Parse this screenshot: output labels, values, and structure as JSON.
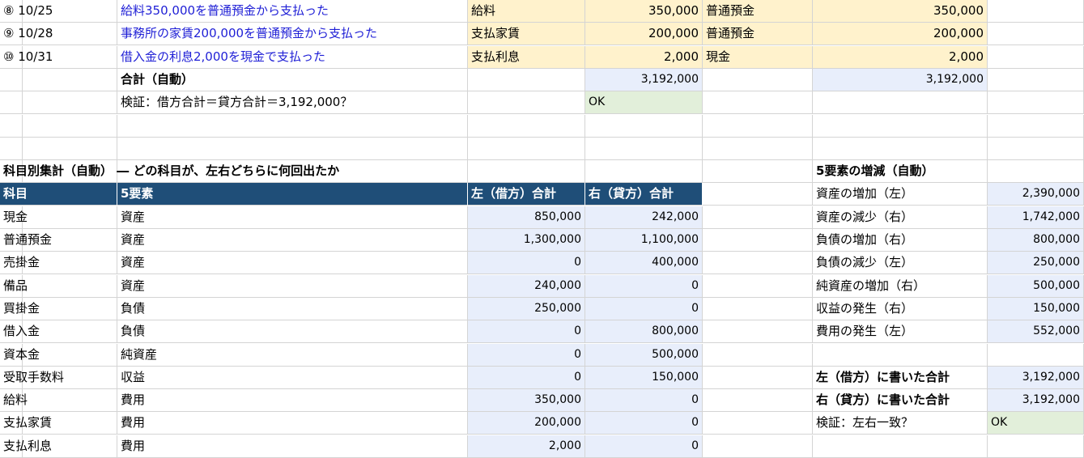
{
  "transactions": [
    {
      "no": "⑧ 10/25",
      "desc": "給料350,000を普通預金から支払った",
      "debit_account": "給料",
      "debit_amount": "350,000",
      "credit_account": "普通預金",
      "credit_amount": "350,000"
    },
    {
      "no": "⑨ 10/28",
      "desc": "事務所の家賃200,000を普通預金から支払った",
      "debit_account": "支払家賃",
      "debit_amount": "200,000",
      "credit_account": "普通預金",
      "credit_amount": "200,000"
    },
    {
      "no": "⑩ 10/31",
      "desc": "借入金の利息2,000を現金で支払った",
      "debit_account": "支払利息",
      "debit_amount": "2,000",
      "credit_account": "現金",
      "credit_amount": "2,000"
    }
  ],
  "totals": {
    "label": "合計（自動）",
    "debit": "3,192,000",
    "credit": "3,192,000"
  },
  "verify": {
    "label": "検証：借方合計＝貸方合計＝3,192,000？",
    "result": "OK"
  },
  "summary": {
    "title": "科目別集計（自動） ― どの科目が、左右どちらに何回出たか",
    "headers": {
      "account": "科目",
      "element": "5要素",
      "left": "左（借方）合計",
      "right": "右（貸方）合計"
    },
    "rows": [
      {
        "account": "現金",
        "element": "資産",
        "left": "850,000",
        "right": "242,000"
      },
      {
        "account": "普通預金",
        "element": "資産",
        "left": "1,300,000",
        "right": "1,100,000"
      },
      {
        "account": "売掛金",
        "element": "資産",
        "left": "0",
        "right": "400,000"
      },
      {
        "account": "備品",
        "element": "資産",
        "left": "240,000",
        "right": "0"
      },
      {
        "account": "買掛金",
        "element": "負債",
        "left": "250,000",
        "right": "0"
      },
      {
        "account": "借入金",
        "element": "負債",
        "left": "0",
        "right": "800,000"
      },
      {
        "account": "資本金",
        "element": "純資産",
        "left": "0",
        "right": "500,000"
      },
      {
        "account": "受取手数料",
        "element": "収益",
        "left": "0",
        "right": "150,000"
      },
      {
        "account": "給料",
        "element": "費用",
        "left": "350,000",
        "right": "0"
      },
      {
        "account": "支払家賃",
        "element": "費用",
        "left": "200,000",
        "right": "0"
      },
      {
        "account": "支払利息",
        "element": "費用",
        "left": "2,000",
        "right": "0"
      }
    ]
  },
  "five": {
    "title": "5要素の増減（自動）",
    "rows": [
      {
        "label": "資産の増加（左）",
        "value": "2,390,000"
      },
      {
        "label": "資産の減少（右）",
        "value": "1,742,000"
      },
      {
        "label": "負債の増加（右）",
        "value": "800,000"
      },
      {
        "label": "負債の減少（左）",
        "value": "250,000"
      },
      {
        "label": "純資産の増加（右）",
        "value": "500,000"
      },
      {
        "label": "収益の発生（右）",
        "value": "150,000"
      },
      {
        "label": "費用の発生（左）",
        "value": "552,000"
      }
    ],
    "left_total_label": "左（借方）に書いた合計",
    "left_total": "3,192,000",
    "right_total_label": "右（貸方）に書いた合計",
    "right_total": "3,192,000",
    "verify_label": "検証：左右一致？",
    "verify_result": "OK"
  }
}
